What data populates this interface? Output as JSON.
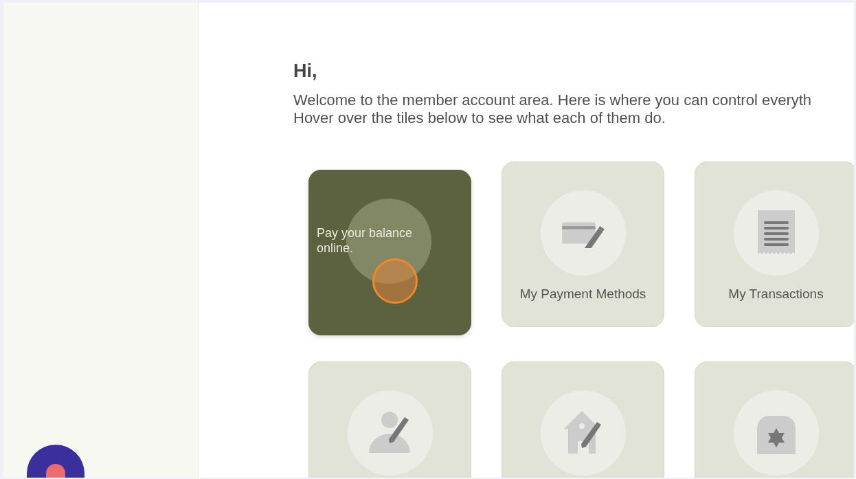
{
  "greeting": "Hi,",
  "intro": [
    "Welcome to the member account area. Here is where you can control everyth",
    "Hover over the tiles below to see what each of them do."
  ],
  "tiles": [
    {
      "kind": "description",
      "hovered": true,
      "text": "Pay your balance online."
    },
    {
      "kind": "label",
      "hovered": false,
      "text": "My Payment Methods"
    },
    {
      "kind": "label",
      "hovered": false,
      "text": "My Transactions"
    },
    {
      "kind": "icon",
      "hovered": false
    },
    {
      "kind": "icon",
      "hovered": false
    },
    {
      "kind": "icon",
      "hovered": false
    }
  ]
}
